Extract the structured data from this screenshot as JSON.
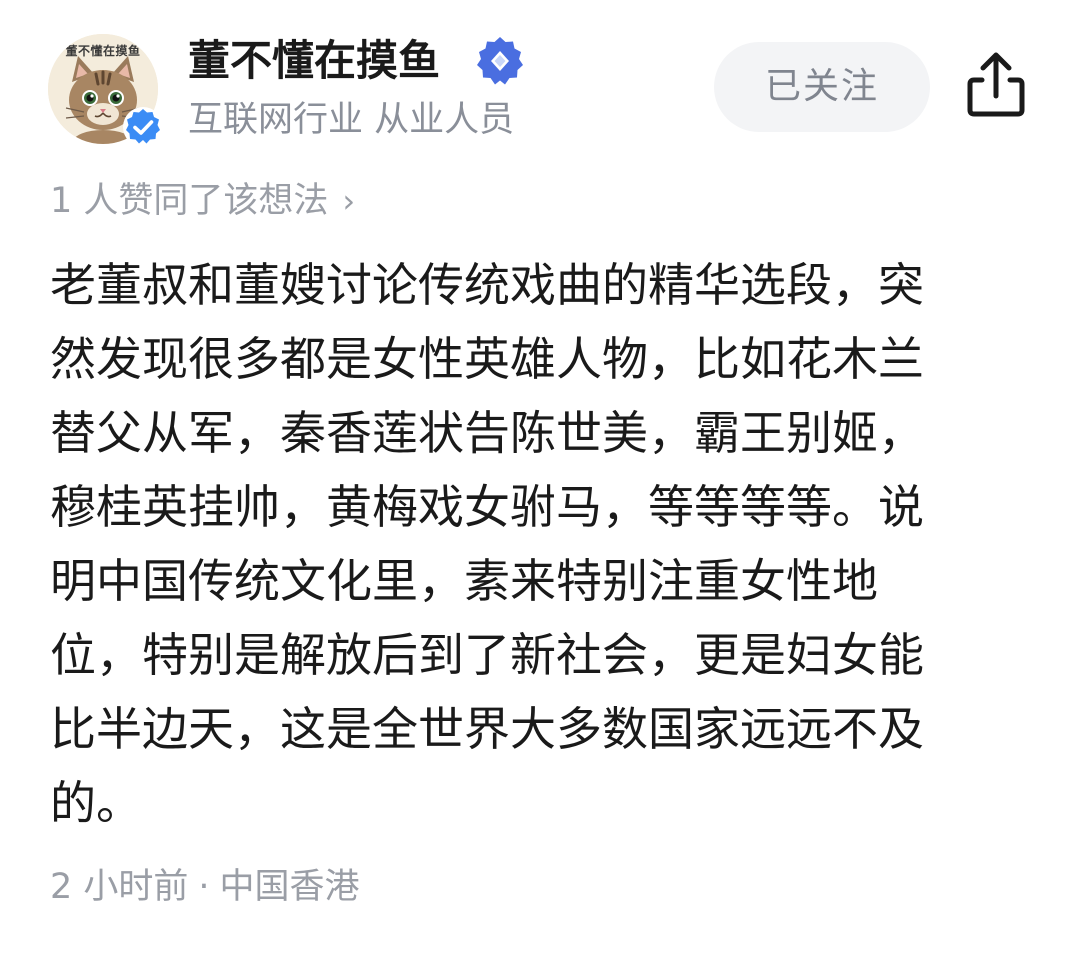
{
  "author": {
    "avatar_caption": "董不懂在摸鱼",
    "name": "董不懂在摸鱼",
    "subtitle": "互联网行业 从业人员"
  },
  "actions": {
    "follow_label": "已关注"
  },
  "likes": {
    "text": "1 人赞同了该想法",
    "chevron": "›"
  },
  "content": {
    "lines": [
      "老董叔和董嫂讨论传统戏曲的精华选段，突",
      "然发现很多都是女性英雄人物，比如花木兰",
      "替父从军，秦香莲状告陈世美，霸王别姬，",
      "穆桂英挂帅，黄梅戏女驸马，等等等等。说",
      "明中国传统文化里，素来特别注重女性地",
      "位，特别是解放后到了新社会，更是妇女能",
      "比半边天，这是全世界大多数国家远远不及",
      "的。"
    ]
  },
  "meta": {
    "time": "2 小时前",
    "separator": "·",
    "location": "中国香港"
  },
  "icons": {
    "avatar": "cat-avatar-icon",
    "verified": "verified-check-icon",
    "level": "diamond-badge-icon",
    "share": "share-icon"
  },
  "colors": {
    "verified_blue": "#3b8cf5",
    "badge_blue": "#4a6ee0",
    "follow_bg": "#f3f4f6",
    "muted_text": "#9a9ea6"
  }
}
